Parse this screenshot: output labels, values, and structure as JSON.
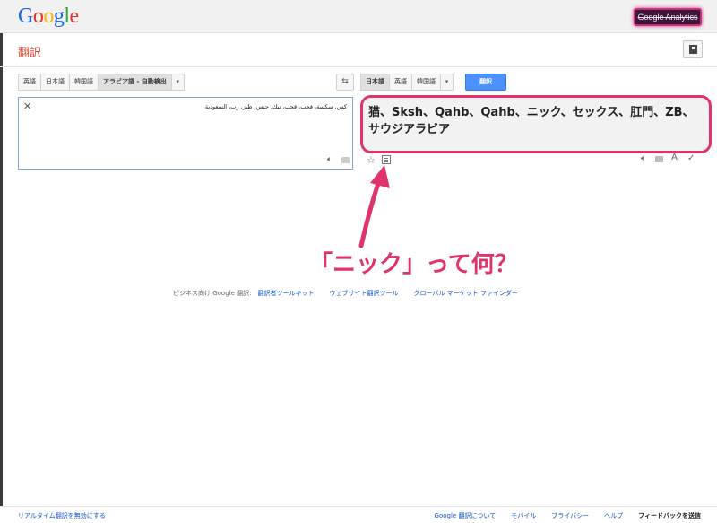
{
  "header": {
    "logo": [
      "G",
      "o",
      "o",
      "g",
      "l",
      "e"
    ],
    "logo_colors": [
      "#1a62e9",
      "#e0372c",
      "#f5b90f",
      "#1a62e9",
      "#2aa24a",
      "#e0372c"
    ],
    "analytics_badge": "Google Analytics"
  },
  "title_row": {
    "title": "翻訳"
  },
  "source_langs": [
    "英語",
    "日本語",
    "韓国語",
    "アラビア語 - 自動検出"
  ],
  "target_langs": [
    "日本語",
    "英語",
    "韓国語"
  ],
  "translate_label": "翻訳",
  "source": {
    "text": "كس، سكسة، قحب، قحب، نيك، جنس، طيز، زب، السعودية"
  },
  "result": {
    "text": "猫、Sksh、Qahb、Qahb、ニック、セックス、肛門、ZB、サウジアラビア"
  },
  "annotation": {
    "caption": "「ニック」って何？",
    "color": "#e0336e"
  },
  "business": {
    "label": "ビジネス向け Google 翻訳:",
    "links": [
      "翻訳者ツールキット",
      "ウェブサイト翻訳ツール",
      "グローバル マーケット ファインダー"
    ]
  },
  "footer": {
    "realtime": "リアルタイム翻訳を無効にする",
    "links": [
      "Google 翻訳について",
      "モバイル",
      "プライバシー",
      "ヘルプ"
    ],
    "feedback": "フィードバックを送信"
  }
}
